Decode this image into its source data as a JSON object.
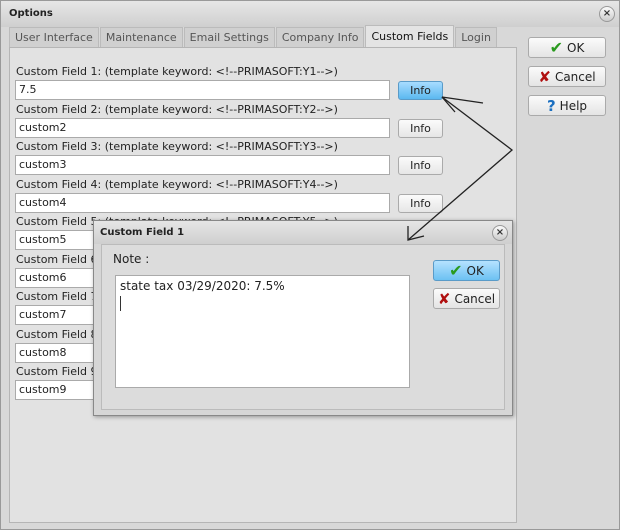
{
  "window": {
    "title": "Options"
  },
  "tabs": [
    {
      "label": "User Interface"
    },
    {
      "label": "Maintenance"
    },
    {
      "label": "Email Settings"
    },
    {
      "label": "Company Info"
    },
    {
      "label": "Custom Fields",
      "active": true
    },
    {
      "label": "Login"
    }
  ],
  "side_buttons": {
    "ok": "OK",
    "cancel": "Cancel",
    "help": "Help"
  },
  "info_label": "Info",
  "fields": [
    {
      "label": "Custom Field 1:   (template keyword: <!--PRIMASOFT:Y1-->)",
      "value": "7.5"
    },
    {
      "label": "Custom Field 2:   (template keyword: <!--PRIMASOFT:Y2-->)",
      "value": "custom2"
    },
    {
      "label": "Custom Field 3:   (template keyword: <!--PRIMASOFT:Y3-->)",
      "value": "custom3"
    },
    {
      "label": "Custom Field 4:   (template keyword: <!--PRIMASOFT:Y4-->)",
      "value": "custom4"
    },
    {
      "label": "Custom Field 5:   (template keyword: <!--PRIMASOFT:Y5-->)",
      "value": "custom5"
    },
    {
      "label": "Custom Field 6:",
      "value": "custom6"
    },
    {
      "label": "Custom Field 7:",
      "value": "custom7"
    },
    {
      "label": "Custom Field 8:",
      "value": "custom8"
    },
    {
      "label": "Custom Field 9:",
      "value": "custom9"
    }
  ],
  "dialog": {
    "title": "Custom Field 1",
    "note_label": "Note :",
    "note_text": "state tax 03/29/2020: 7.5%",
    "ok": "OK",
    "cancel": "Cancel"
  }
}
